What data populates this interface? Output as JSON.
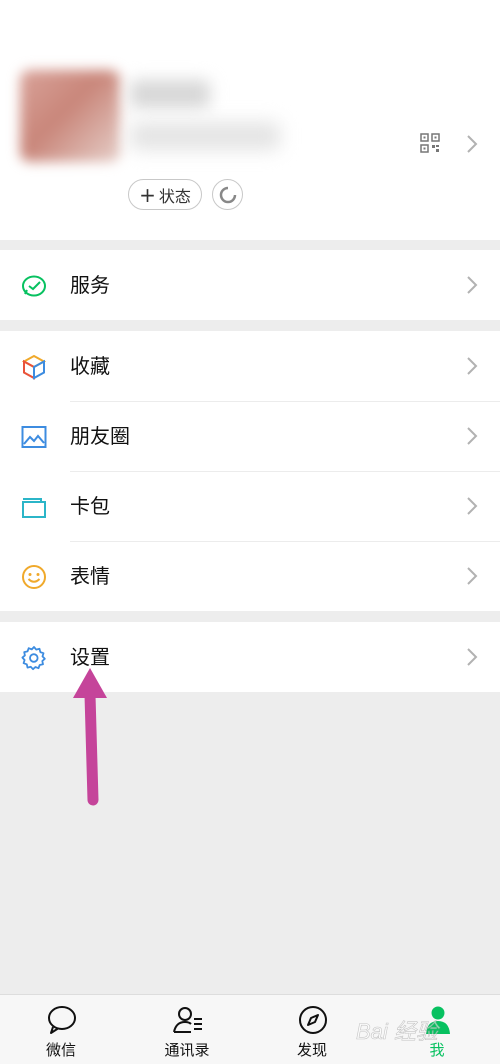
{
  "profile": {
    "status_label": "状态"
  },
  "menu": {
    "service": "服务",
    "favorites": "收藏",
    "moments": "朋友圈",
    "cards": "卡包",
    "stickers": "表情",
    "settings": "设置"
  },
  "tabs": [
    {
      "label": "微信",
      "icon": "chat-bubble-icon"
    },
    {
      "label": "通讯录",
      "icon": "contacts-icon"
    },
    {
      "label": "发现",
      "icon": "compass-icon"
    },
    {
      "label": "我",
      "icon": "me-icon",
      "active": true
    }
  ],
  "colors": {
    "accent_green": "#07c160",
    "annotation_arrow": "#c5449a"
  },
  "watermark_text": "Bai 经验"
}
